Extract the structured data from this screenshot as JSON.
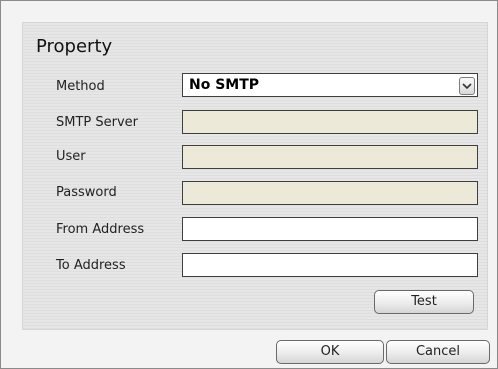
{
  "panel": {
    "title": "Property"
  },
  "labels": {
    "method": "Method",
    "smtp_server": "SMTP Server",
    "user": "User",
    "password": "Password",
    "from_address": "From Address",
    "to_address": "To Address"
  },
  "fields": {
    "method_value": "No SMTP",
    "smtp_server": "",
    "user": "",
    "password": "",
    "from_address": "",
    "to_address": ""
  },
  "buttons": {
    "test": "Test",
    "ok": "OK",
    "cancel": "Cancel"
  },
  "icons": {
    "dropdown": "chevron-down-icon"
  },
  "colors": {
    "disabled_field": "#ece9d9"
  }
}
